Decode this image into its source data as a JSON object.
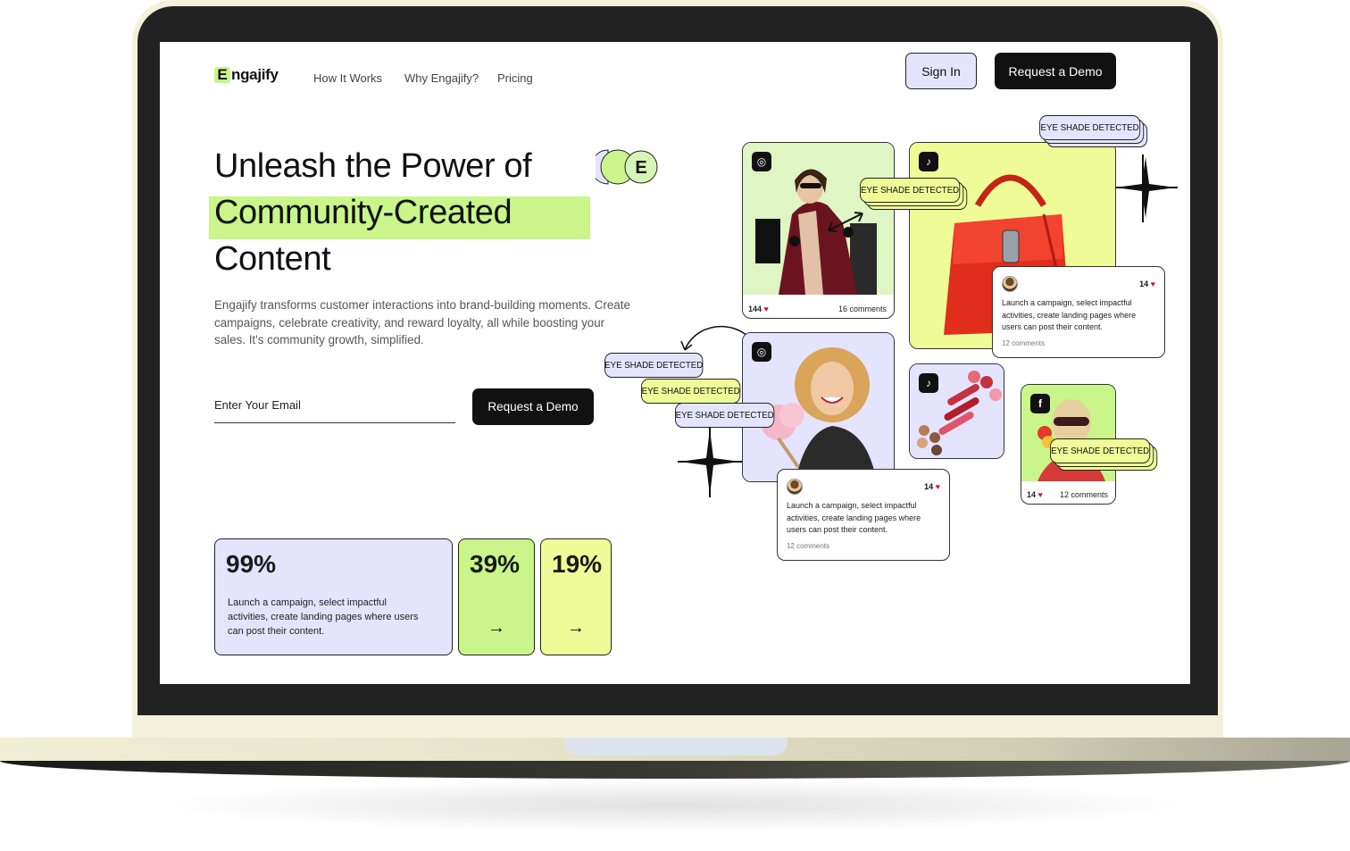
{
  "brand": {
    "logo_letter": "E",
    "logo_rest": "ngajify",
    "accent_green": "#c9f58a",
    "accent_lavender": "#e4e4ff",
    "accent_yellow": "#eefb96"
  },
  "nav": {
    "links": [
      "How It Works",
      "Why Engajify?",
      "Pricing"
    ],
    "sign_in": "Sign In",
    "request_demo": "Request a Demo"
  },
  "hero": {
    "line1": "Unleash the Power of",
    "line2": "Community-Created",
    "line3": "Content",
    "badge_letter": "E",
    "description": "Engajify transforms customer interactions into brand-building moments. Create campaigns, celebrate creativity, and reward loyalty, all while boosting your sales. It's community growth, simplified.",
    "email_placeholder": "Enter Your Email",
    "cta": "Request a Demo"
  },
  "stats": [
    {
      "value": "99%",
      "description": "Launch a campaign, select impactful activities, create landing pages where users can post their content."
    },
    {
      "value": "39%",
      "arrow": "→"
    },
    {
      "value": "19%",
      "arrow": "→"
    }
  ],
  "collage": {
    "tile1": {
      "network": "instagram-icon",
      "likes": "144",
      "comments": "16 comments"
    },
    "tile2": {
      "network": "tiktok-icon"
    },
    "tile3": {
      "network": "instagram-icon"
    },
    "tile4": {
      "network": "tiktok-icon"
    },
    "tile5": {
      "network": "facebook-icon",
      "likes": "14",
      "comments": "12 comments"
    },
    "detection_label": "EYE SHADE DETECTED",
    "comment_card": {
      "likes": "14",
      "text": "Launch a campaign, select impactful activities, create landing pages where users can post their content.",
      "comments": "12 comments"
    }
  }
}
